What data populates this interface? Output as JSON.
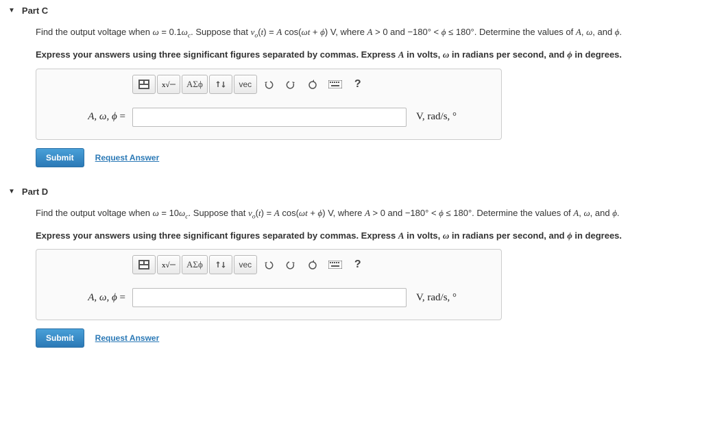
{
  "parts": [
    {
      "title": "Part C",
      "prompt_html": "Find the output voltage when <span class='math-i'>ω</span> = 0.1<span class='math-i'>ω<sub>c</sub></span>. Suppose that <span class='math-i'>v<sub>o</sub></span>(<span class='math-i'>t</span>) = <span class='math-i'>A</span> cos(<span class='math-i'>ωt</span> + <span class='math-i'>ϕ</span>) V, where <span class='math-i'>A</span> &gt; 0 and −180° &lt; <span class='math-i'>ϕ</span> ≤ 180°. Determine the values of <span class='math-i'>A</span>, <span class='math-i'>ω</span>, and <span class='math-i'>ϕ</span>.",
      "instruction_html": "<b>Express your answers using three significant figures separated by commas. Express <span class='math-i'>A</span> in volts, <span class='math-i'>ω</span> in radians per second, and <span class='math-i'>ϕ</span> in degrees.</b>",
      "var_label_html": "<span class='math-i'>A</span>, <span class='math-i'>ω</span>, <span class='math-i'>ϕ</span> <span class='upright'>=</span>",
      "units_html": "V, rad/s, °",
      "submit": "Submit",
      "request": "Request Answer"
    },
    {
      "title": "Part D",
      "prompt_html": "Find the output voltage when <span class='math-i'>ω</span> = 10<span class='math-i'>ω<sub>c</sub></span>. Suppose that <span class='math-i'>v<sub>o</sub></span>(<span class='math-i'>t</span>) = <span class='math-i'>A</span> cos(<span class='math-i'>ωt</span> + <span class='math-i'>ϕ</span>) V, where <span class='math-i'>A</span> &gt; 0 and −180° &lt; <span class='math-i'>ϕ</span> ≤ 180°. Determine the values of <span class='math-i'>A</span>, <span class='math-i'>ω</span>, and <span class='math-i'>ϕ</span>.",
      "instruction_html": "<b>Express your answers using three significant figures separated by commas. Express <span class='math-i'>A</span> in volts, <span class='math-i'>ω</span> in radians per second, and <span class='math-i'>ϕ</span> in degrees.</b>",
      "var_label_html": "<span class='math-i'>A</span>, <span class='math-i'>ω</span>, <span class='math-i'>ϕ</span> <span class='upright'>=</span>",
      "units_html": "V, rad/s, °",
      "submit": "Submit",
      "request": "Request Answer"
    }
  ],
  "toolbar": {
    "greek": "ΑΣϕ",
    "vec": "vec",
    "help": "?"
  }
}
